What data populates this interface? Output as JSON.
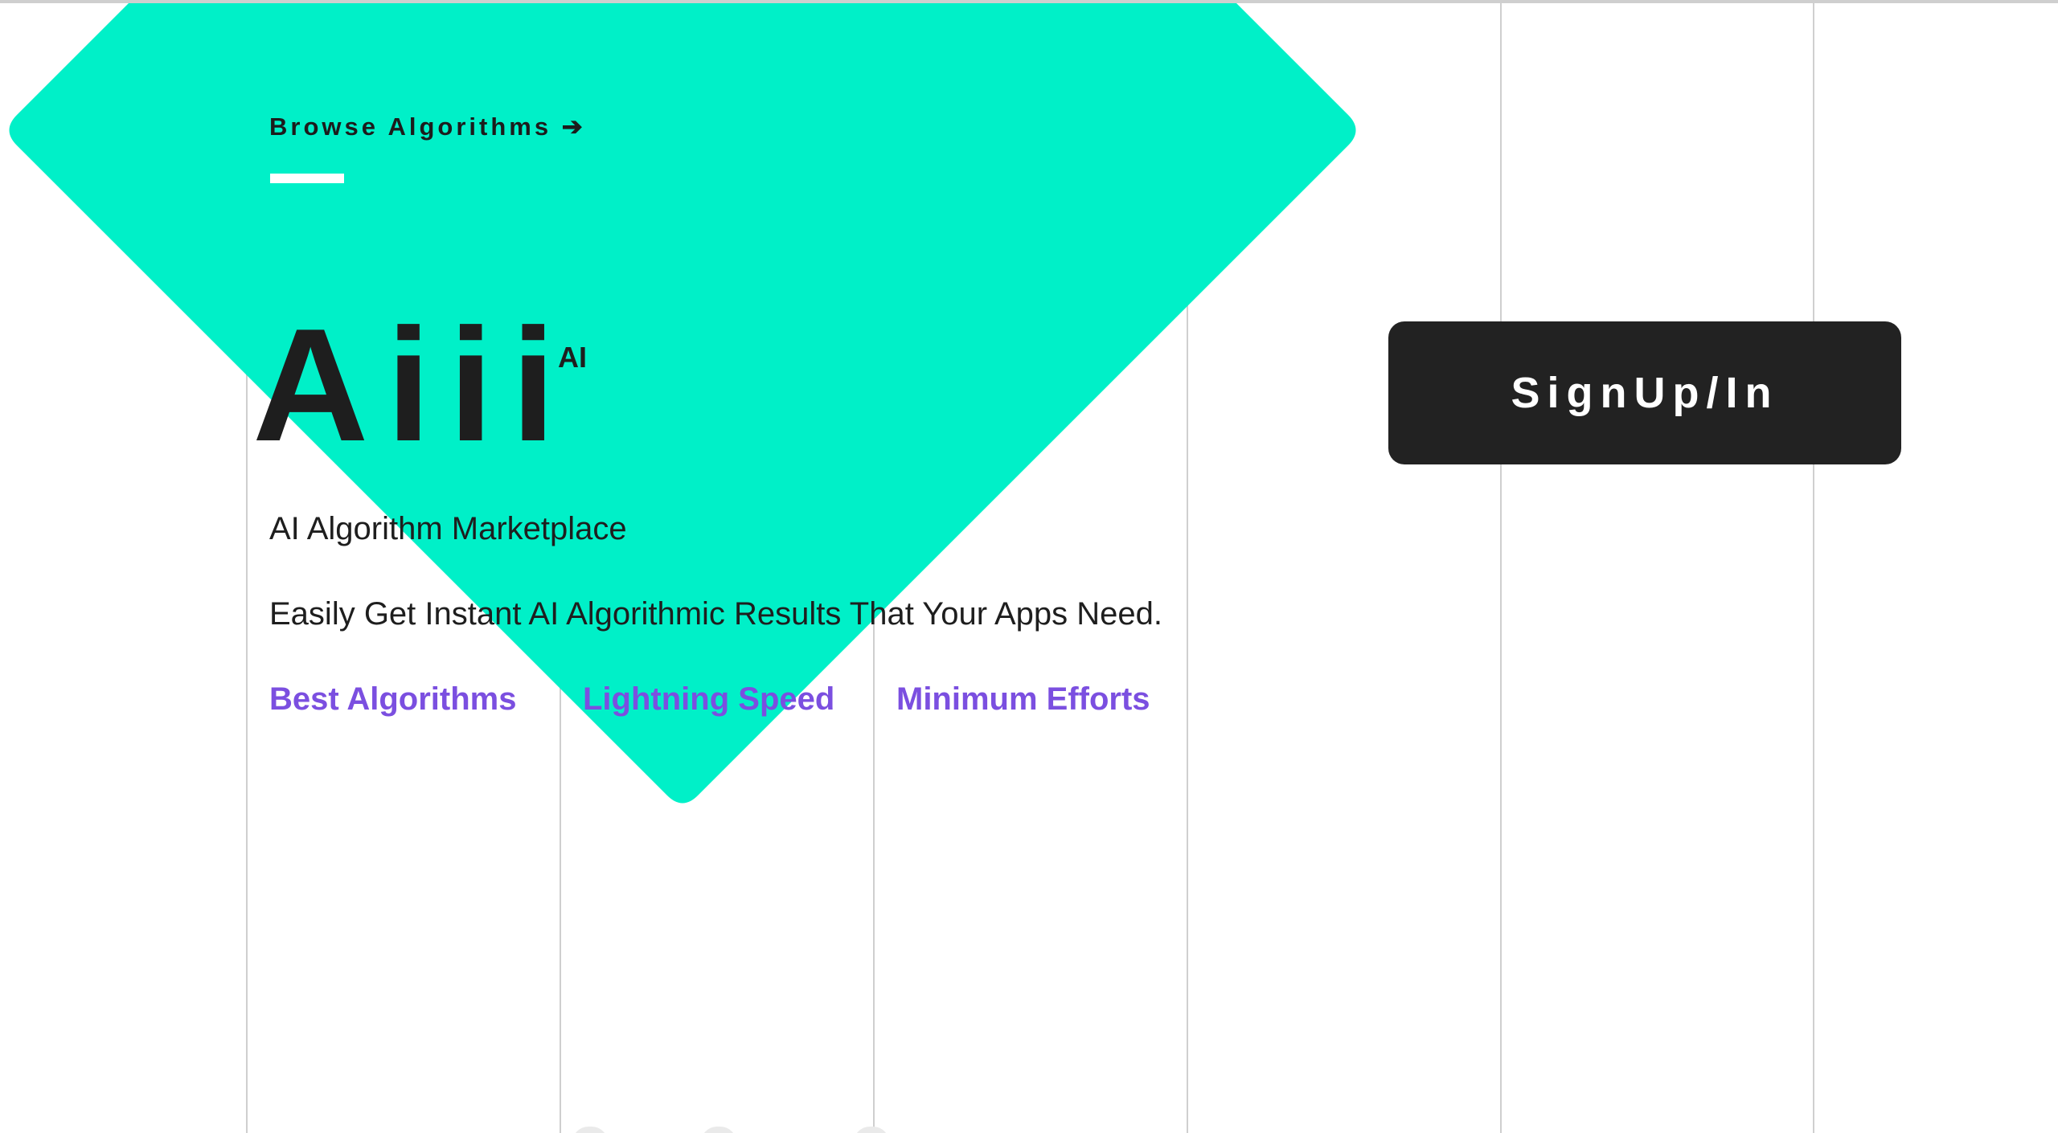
{
  "nav": {
    "browse_label": "Browse Algorithms",
    "browse_arrow": "➔"
  },
  "brand": {
    "logo_text": "Aiii",
    "logo_badge": "AI",
    "subtitle": "AI Algorithm Marketplace",
    "tagline": "Easily Get Instant AI Algorithmic Results That Your Apps Need."
  },
  "features": [
    {
      "label": "Best Algorithms"
    },
    {
      "label": "Lightning Speed"
    },
    {
      "label": "Minimum Efforts"
    }
  ],
  "auth": {
    "signup_label": "SignUp/In"
  },
  "colors": {
    "accent": "#00f0c8",
    "feature_text": "#7b4fe0",
    "button_bg": "#222222",
    "text": "#1e1e1e",
    "grid_line": "#cfcfcf"
  },
  "icons": {
    "browse_arrow": "arrow-right-icon"
  }
}
